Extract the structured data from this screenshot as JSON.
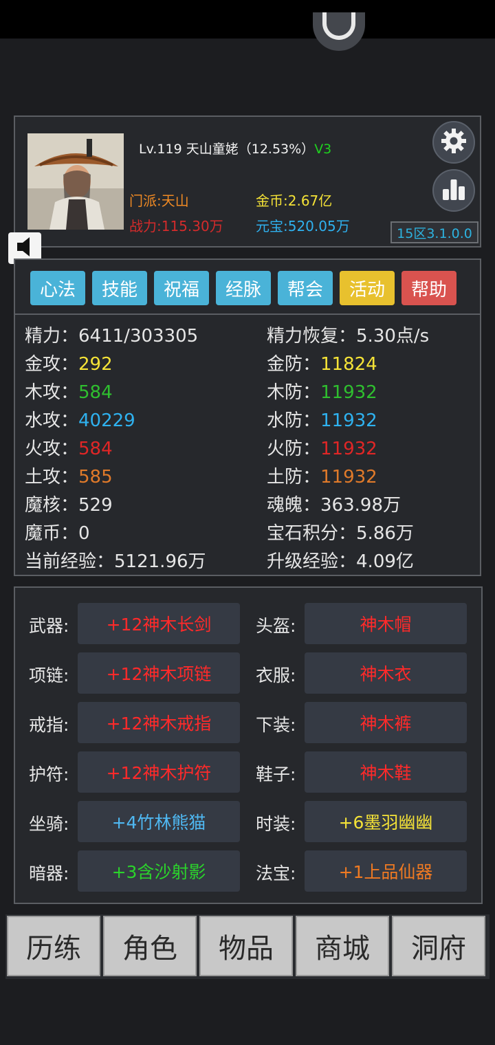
{
  "profile": {
    "level": "Lv.119",
    "name": "天山童姥",
    "exp_percent": "（12.53%）",
    "vip": "V3",
    "sect": "门派:天山",
    "power": "战力:115.30万",
    "gold": "金币:2.67亿",
    "ingot": "元宝:520.05万",
    "server": "15区3.1.0.0"
  },
  "tabs": [
    {
      "label": "心法",
      "color": "#4ab3d8"
    },
    {
      "label": "技能",
      "color": "#4ab3d8"
    },
    {
      "label": "祝福",
      "color": "#4ab3d8"
    },
    {
      "label": "经脉",
      "color": "#4ab3d8"
    },
    {
      "label": "帮会",
      "color": "#4ab3d8"
    },
    {
      "label": "活动",
      "color": "#e8c12e"
    },
    {
      "label": "帮助",
      "color": "#d9534f"
    }
  ],
  "stats_left": [
    {
      "label": "精力：",
      "value": "6411/303305",
      "color": "#e6e6e6"
    },
    {
      "label": "金攻：",
      "value": "292",
      "color": "#f5e337"
    },
    {
      "label": "木攻：",
      "value": "584",
      "color": "#2fbf2f"
    },
    {
      "label": "水攻：",
      "value": "40229",
      "color": "#2fb2f0"
    },
    {
      "label": "火攻：",
      "value": "584",
      "color": "#e02626"
    },
    {
      "label": "土攻：",
      "value": "585",
      "color": "#e07a2a"
    },
    {
      "label": "魔核：",
      "value": "529",
      "color": "#e6e6e6"
    },
    {
      "label": "魔币：",
      "value": "0",
      "color": "#e6e6e6"
    },
    {
      "label": "当前经验：",
      "value": "5121.96万",
      "color": "#e6e6e6"
    }
  ],
  "stats_right": [
    {
      "label": "精力恢复：",
      "value": "5.30点/s",
      "color": "#e6e6e6"
    },
    {
      "label": "金防：",
      "value": "11824",
      "color": "#f5e337"
    },
    {
      "label": "木防：",
      "value": "11932",
      "color": "#2fbf2f"
    },
    {
      "label": "水防：",
      "value": "11932",
      "color": "#2fb2f0"
    },
    {
      "label": "火防：",
      "value": "11932",
      "color": "#e02626"
    },
    {
      "label": "土防：",
      "value": "11932",
      "color": "#e07a2a"
    },
    {
      "label": "魂魄：",
      "value": "363.98万",
      "color": "#e6e6e6"
    },
    {
      "label": "宝石积分：",
      "value": "5.86万",
      "color": "#e6e6e6"
    },
    {
      "label": "升级经验：",
      "value": "4.09亿",
      "color": "#e6e6e6"
    }
  ],
  "equipment_left": [
    {
      "label": "武器:",
      "item": "+12神木长剑",
      "color": "#ff2a2a"
    },
    {
      "label": "项链:",
      "item": "+12神木项链",
      "color": "#ff2a2a"
    },
    {
      "label": "戒指:",
      "item": "+12神木戒指",
      "color": "#ff2a2a"
    },
    {
      "label": "护符:",
      "item": "+12神木护符",
      "color": "#ff2a2a"
    },
    {
      "label": "坐骑:",
      "item": "+4竹林熊猫",
      "color": "#4fb8f2"
    },
    {
      "label": "暗器:",
      "item": "+3含沙射影",
      "color": "#2bd42b"
    }
  ],
  "equipment_right": [
    {
      "label": "头盔:",
      "item": "神木帽",
      "color": "#ff2a2a"
    },
    {
      "label": "衣服:",
      "item": "神木衣",
      "color": "#ff2a2a"
    },
    {
      "label": "下装:",
      "item": "神木裤",
      "color": "#ff2a2a"
    },
    {
      "label": "鞋子:",
      "item": "神木鞋",
      "color": "#ff2a2a"
    },
    {
      "label": "时装:",
      "item": "+6墨羽幽幽",
      "color": "#f5e337"
    },
    {
      "label": "法宝:",
      "item": "+1上品仙器",
      "color": "#f07a22"
    }
  ],
  "nav": [
    "历练",
    "角色",
    "物品",
    "商城",
    "洞府"
  ],
  "icons": {
    "settings": "gear-icon",
    "ranking": "bar-chart-icon",
    "sound": "speaker-icon"
  }
}
